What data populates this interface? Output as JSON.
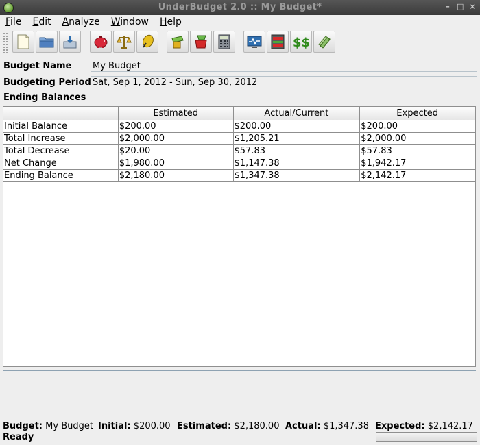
{
  "window": {
    "title": "UnderBudget 2.0 :: My Budget*"
  },
  "menu": [
    {
      "mnemonic": "F",
      "rest": "ile"
    },
    {
      "mnemonic": "E",
      "rest": "dit"
    },
    {
      "mnemonic": "A",
      "rest": "nalyze"
    },
    {
      "mnemonic": "W",
      "rest": "indow"
    },
    {
      "mnemonic": "H",
      "rest": "elp"
    }
  ],
  "toolbar": {
    "icons": [
      "new-file-icon",
      "open-folder-icon",
      "save-icon",
      "piggy-bank-icon",
      "balance-scale-icon",
      "coins-icon",
      "wallet-icon",
      "money-jar-icon",
      "calculator-icon",
      "monitor-chart-icon",
      "ledger-icon",
      "dollar-signs-icon",
      "money-stack-icon"
    ]
  },
  "form": {
    "name_label": "Budget Name",
    "name_value": "My Budget",
    "period_label": "Budgeting Period",
    "period_value": "Sat, Sep 1, 2012 - Sun, Sep 30, 2012",
    "section_label": "Ending Balances"
  },
  "table": {
    "headers": [
      "",
      "Estimated",
      "Actual/Current",
      "Expected"
    ],
    "rows": [
      [
        "Initial Balance",
        "$200.00",
        "$200.00",
        "$200.00"
      ],
      [
        "Total Increase",
        "$2,000.00",
        "$1,205.21",
        "$2,000.00"
      ],
      [
        "Total Decrease",
        "$20.00",
        "$57.83",
        "$57.83"
      ],
      [
        "Net Change",
        "$1,980.00",
        "$1,147.38",
        "$1,942.17"
      ],
      [
        "Ending Balance",
        "$2,180.00",
        "$1,347.38",
        "$2,142.17"
      ]
    ]
  },
  "status": {
    "budget_label": "Budget:",
    "budget_value": "My Budget",
    "initial_label": "Initial:",
    "initial_value": "$200.00",
    "estimated_label": "Estimated:",
    "estimated_value": "$2,180.00",
    "actual_label": "Actual:",
    "actual_value": "$1,347.38",
    "expected_label": "Expected:",
    "expected_value": "$2,142.17",
    "ready": "Ready"
  }
}
